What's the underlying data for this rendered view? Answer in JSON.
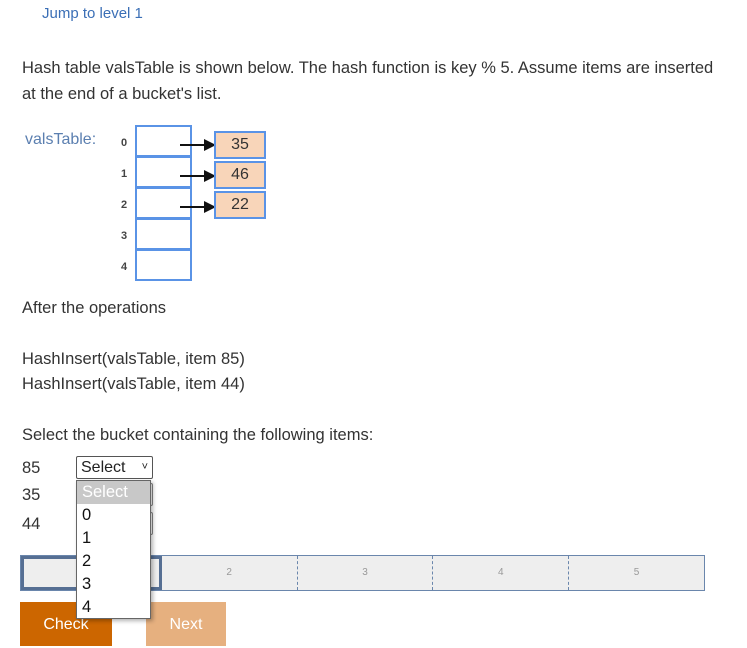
{
  "jump_link": "Jump to level 1",
  "prompt": "Hash table valsTable is shown below. The hash function is key % 5. Assume items are inserted at the end of a bucket's list.",
  "table": {
    "name": "valsTable:",
    "indices": [
      "0",
      "1",
      "2",
      "3",
      "4"
    ],
    "items": [
      {
        "bucket": 0,
        "value": "35"
      },
      {
        "bucket": 1,
        "value": "46"
      },
      {
        "bucket": 2,
        "value": "22"
      }
    ]
  },
  "after": "After the operations",
  "operations": [
    "HashInsert(valsTable, item 85)",
    "HashInsert(valsTable, item 44)"
  ],
  "question": "Select the bucket containing the following items:",
  "rows": [
    {
      "label": "85",
      "selected": "Select"
    },
    {
      "label": "35",
      "selected": "Select"
    },
    {
      "label": "44",
      "selected": "Select"
    }
  ],
  "dropdown_options": [
    "Select",
    "0",
    "1",
    "2",
    "3",
    "4"
  ],
  "progress": {
    "levels": [
      "1",
      "2",
      "3",
      "4",
      "5"
    ],
    "current": 1
  },
  "buttons": {
    "check": "Check",
    "next": "Next"
  },
  "colors": {
    "accent": "#cc6600",
    "item_fill": "#f8d5b9",
    "bucket_border": "#5a93e6"
  }
}
